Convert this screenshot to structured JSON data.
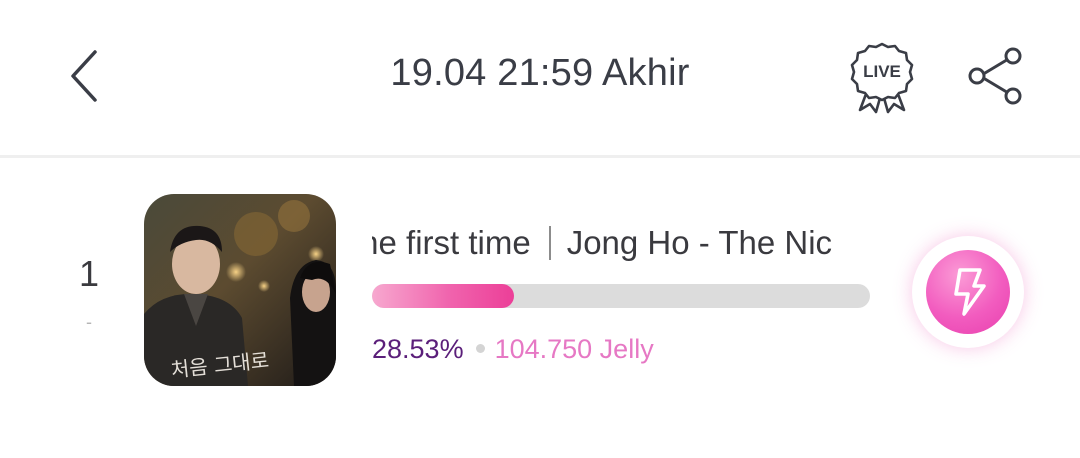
{
  "header": {
    "title": "19.04 21:59 Akhir",
    "live_label": "LIVE"
  },
  "entry": {
    "rank": "1",
    "rank_change": "-",
    "song_title": "The first time",
    "artist": "Jong Ho - The Nic",
    "progress_percent": 28.53,
    "percent_text": "28.53%",
    "jelly_text": "104.750 Jelly",
    "cover_text": "처음 그대로"
  },
  "colors": {
    "accent_pink": "#ec3f98",
    "percent_purple": "#5b1f7a",
    "jelly_pink": "#e678c4",
    "track_gray": "#dcdcdc"
  },
  "icons": [
    "chevron-left-icon",
    "live-badge-icon",
    "share-icon",
    "lightning-icon"
  ]
}
